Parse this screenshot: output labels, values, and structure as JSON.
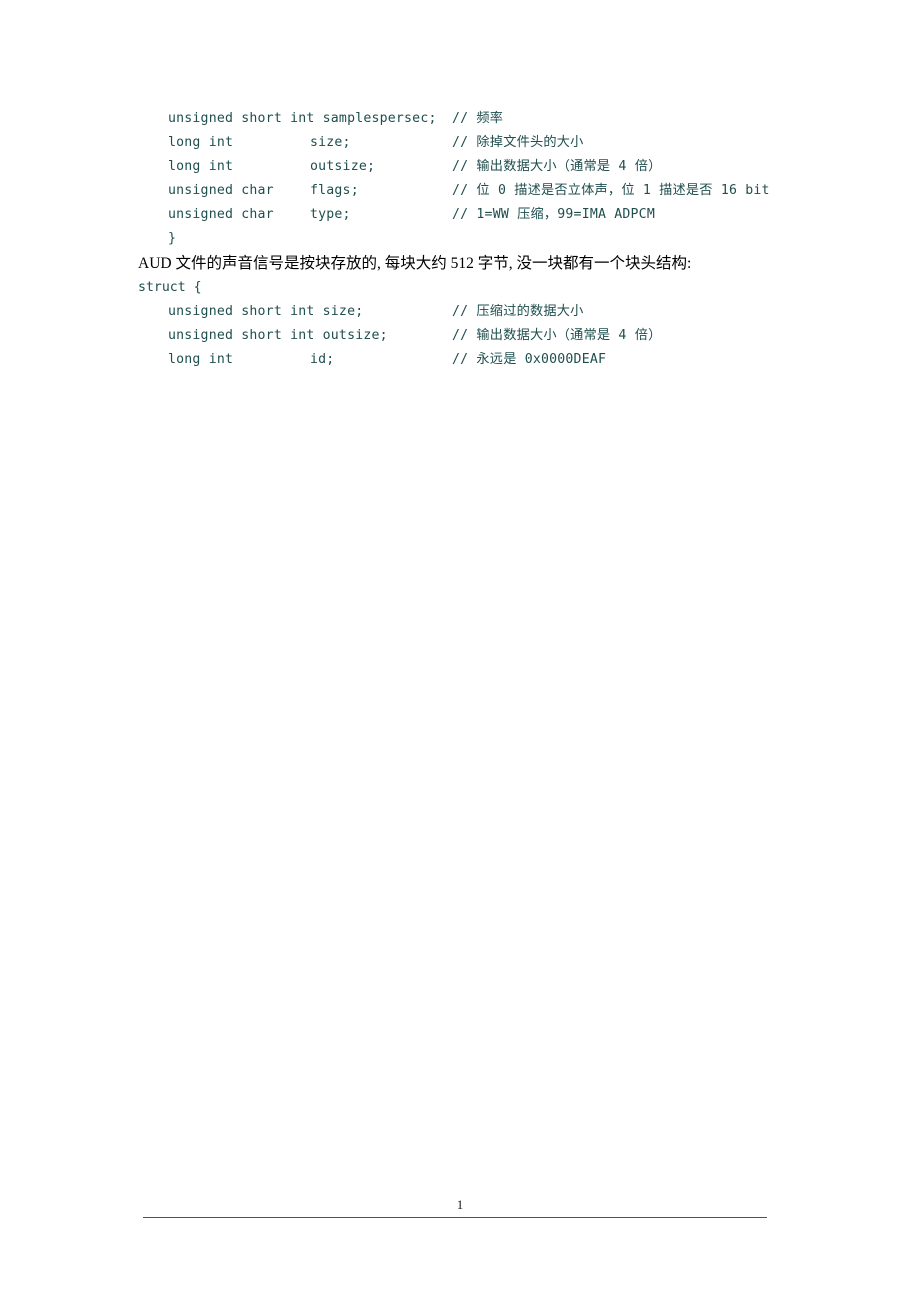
{
  "document": {
    "page_number": "1",
    "code_color": "#1f4e4e",
    "text_color": "#000000",
    "rule_color": "#5a4a63",
    "background": "#ffffff"
  },
  "struct_one": {
    "rows": [
      {
        "decl": "unsigned short int samplespersec;",
        "type": "",
        "name": "",
        "comment": "// 频率"
      },
      {
        "decl": "",
        "type": "long int",
        "name": "size;",
        "comment": "// 除掉文件头的大小"
      },
      {
        "decl": "",
        "type": "long int",
        "name": "outsize;",
        "comment": "// 输出数据大小（通常是 4 倍）"
      },
      {
        "decl": "",
        "type": "unsigned char",
        "name": "flags;",
        "comment": "// 位 0 描述是否立体声，位 1 描述是否 16 bit"
      },
      {
        "decl": "",
        "type": "unsigned char",
        "name": "type;",
        "comment": "// 1=WW 压缩，99=IMA ADPCM"
      }
    ],
    "closing_brace": "}"
  },
  "paragraph": {
    "text": "AUD 文件的声音信号是按块存放的, 每块大约 512 字节, 没一块都有一个块头结构:"
  },
  "struct_two": {
    "opening": "struct {",
    "rows": [
      {
        "decl": "unsigned short int size;",
        "type": "",
        "name": "",
        "comment": "// 压缩过的数据大小"
      },
      {
        "decl": "unsigned short int outsize;",
        "type": "",
        "name": "",
        "comment": "// 输出数据大小（通常是 4 倍）"
      },
      {
        "decl": "",
        "type": "long int",
        "name": "id;",
        "comment": "// 永远是 0x0000DEAF"
      }
    ]
  }
}
